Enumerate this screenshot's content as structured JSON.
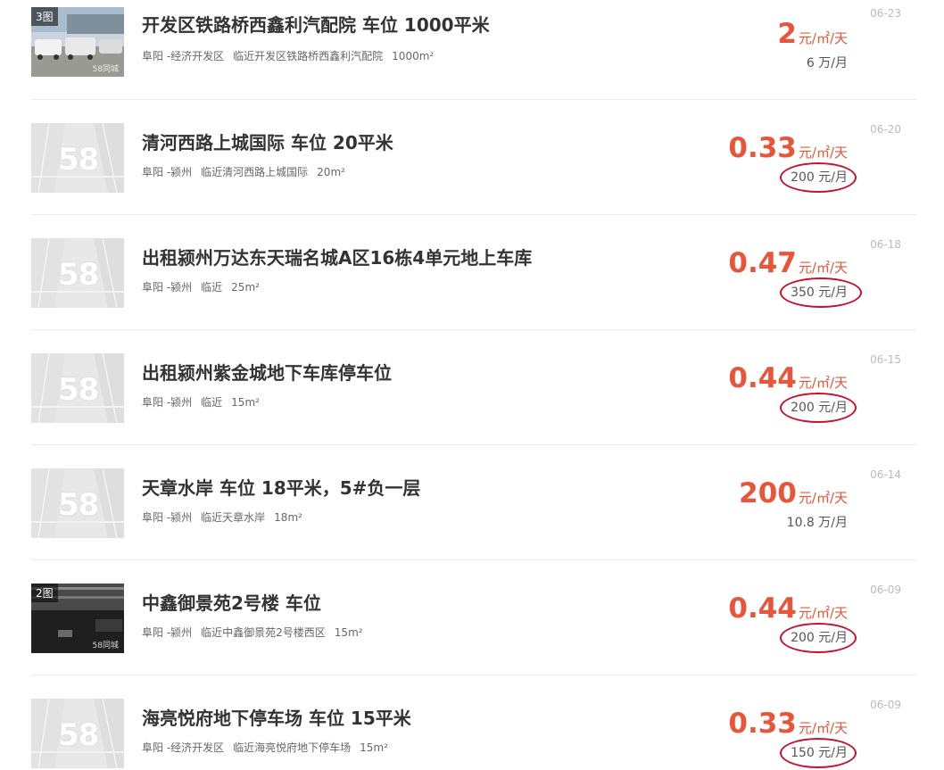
{
  "listings": [
    {
      "image_badge": "3图",
      "image_type": "photo",
      "title": "开发区铁路桥西鑫利汽配院 车位 1000平米",
      "city": "阜阳 -经济开发区",
      "near": "临近开发区铁路桥西鑫利汽配院",
      "area": "1000m²",
      "price": "2",
      "price_unit": "元/㎡/天",
      "sub_price": "6 万/月",
      "sub_circled": false,
      "date": "06-23"
    },
    {
      "image_badge": "",
      "image_type": "placeholder",
      "placeholder_logo": "58",
      "title": "清河西路上城国际 车位 20平米",
      "city": "阜阳 -颍州",
      "near": "临近清河西路上城国际",
      "area": "20m²",
      "price": "0.33",
      "price_unit": "元/㎡/天",
      "sub_price": "200 元/月",
      "sub_circled": true,
      "date": "06-20"
    },
    {
      "image_badge": "",
      "image_type": "placeholder",
      "placeholder_logo": "58",
      "title": "出租颍州万达东天瑞名城A区16栋4单元地上车库",
      "city": "阜阳 -颍州",
      "near": "临近",
      "area": "25m²",
      "price": "0.47",
      "price_unit": "元/㎡/天",
      "sub_price": "350 元/月",
      "sub_circled": true,
      "date": "06-18"
    },
    {
      "image_badge": "",
      "image_type": "placeholder",
      "placeholder_logo": "58",
      "title": "出租颍州紫金城地下车库停车位",
      "city": "阜阳 -颍州",
      "near": "临近",
      "area": "15m²",
      "price": "0.44",
      "price_unit": "元/㎡/天",
      "sub_price": "200 元/月",
      "sub_circled": true,
      "date": "06-15"
    },
    {
      "image_badge": "",
      "image_type": "placeholder",
      "placeholder_logo": "58",
      "title": "天章水岸 车位 18平米，5#负一层",
      "city": "阜阳 -颍州",
      "near": "临近天章水岸",
      "area": "18m²",
      "price": "200",
      "price_unit": "元/㎡/天",
      "sub_price": "10.8 万/月",
      "sub_circled": false,
      "date": "06-14"
    },
    {
      "image_badge": "2图",
      "image_type": "photo-dark",
      "title": "中鑫御景苑2号楼 车位",
      "city": "阜阳 -颍州",
      "near": "临近中鑫御景苑2号楼西区",
      "area": "15m²",
      "price": "0.44",
      "price_unit": "元/㎡/天",
      "sub_price": "200 元/月",
      "sub_circled": true,
      "date": "06-09"
    },
    {
      "image_badge": "",
      "image_type": "placeholder",
      "placeholder_logo": "58",
      "title": "海亮悦府地下停车场 车位 15平米",
      "city": "阜阳 -经济开发区",
      "near": "临近海亮悦府地下停车场",
      "area": "15m²",
      "price": "0.33",
      "price_unit": "元/㎡/天",
      "sub_price": "150 元/月",
      "sub_circled": true,
      "date": "06-09"
    }
  ],
  "photo_watermark": "58同城",
  "colors": {
    "price": "#e8553a",
    "circle": "#c8102e",
    "divider": "#ececec",
    "date": "#bbbbbb"
  }
}
